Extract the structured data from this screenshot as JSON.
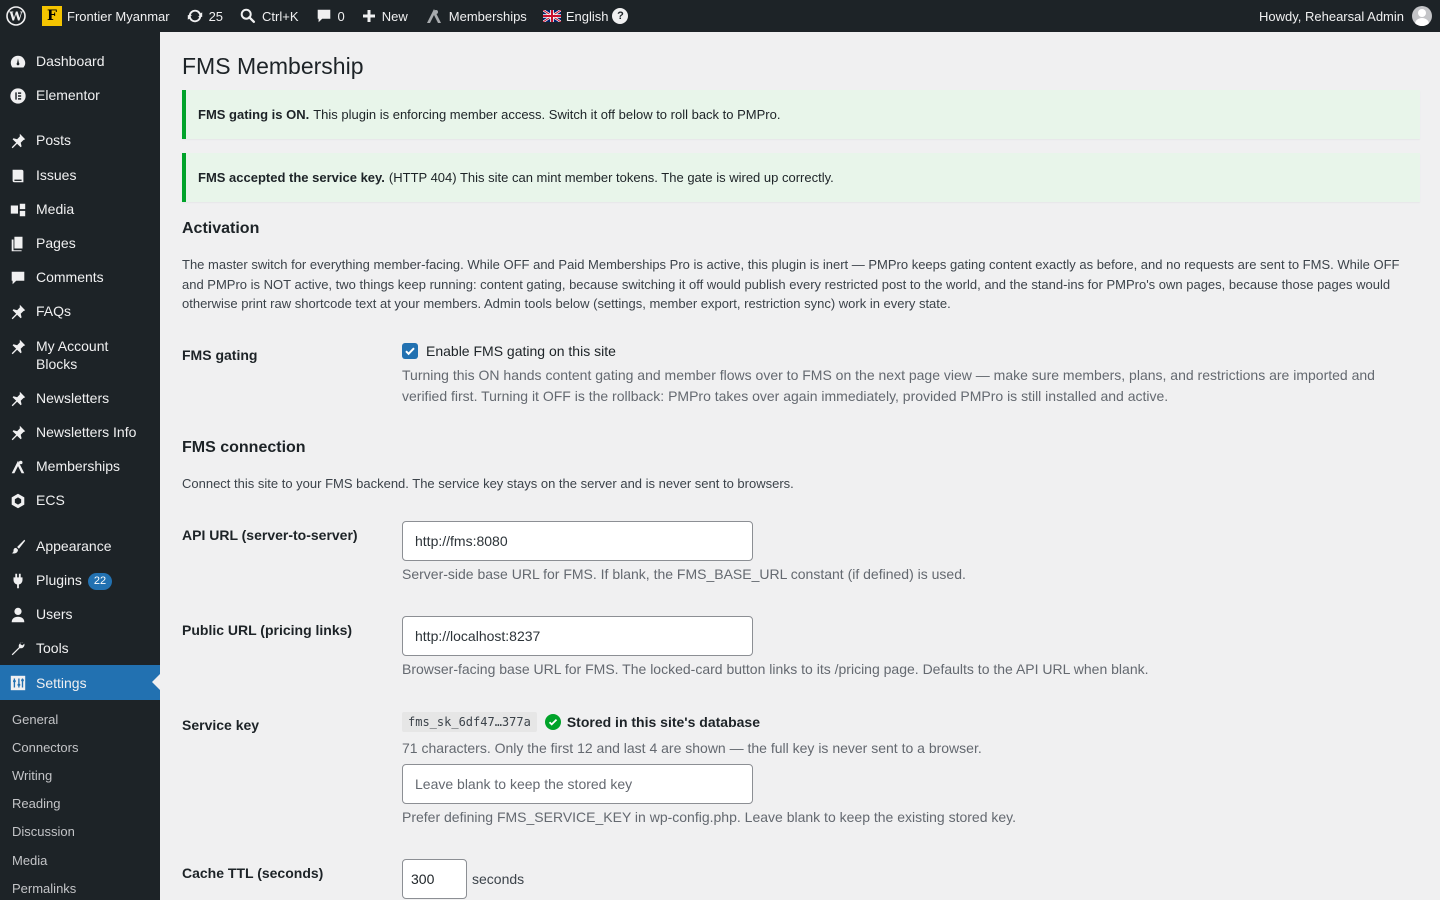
{
  "adminbar": {
    "site_name": "Frontier Myanmar",
    "site_logo_letter": "F",
    "updates_count": "25",
    "search_shortcut": "Ctrl+K",
    "comments_count": "0",
    "new_label": "New",
    "memberships_label": "Memberships",
    "language_label": "English",
    "help_glyph": "?",
    "greeting": "Howdy, Rehearsal Admin"
  },
  "sidebar": {
    "items": [
      {
        "label": "Dashboard",
        "icon": "dashboard-icon"
      },
      {
        "label": "Elementor",
        "icon": "elementor-icon"
      },
      {
        "label": "Posts",
        "icon": "pin-icon"
      },
      {
        "label": "Issues",
        "icon": "book-icon"
      },
      {
        "label": "Media",
        "icon": "media-icon"
      },
      {
        "label": "Pages",
        "icon": "pages-icon"
      },
      {
        "label": "Comments",
        "icon": "comment-icon"
      },
      {
        "label": "FAQs",
        "icon": "pin-icon"
      },
      {
        "label": "My Account Blocks",
        "icon": "pin-icon"
      },
      {
        "label": "Newsletters",
        "icon": "pin-icon"
      },
      {
        "label": "Newsletters Info",
        "icon": "pin-icon"
      },
      {
        "label": "Memberships",
        "icon": "memberships-icon"
      },
      {
        "label": "ECS",
        "icon": "ecs-icon"
      },
      {
        "label": "Appearance",
        "icon": "brush-icon"
      },
      {
        "label": "Plugins",
        "icon": "plug-icon",
        "badge": "22"
      },
      {
        "label": "Users",
        "icon": "user-icon"
      },
      {
        "label": "Tools",
        "icon": "wrench-icon"
      },
      {
        "label": "Settings",
        "icon": "settings-icon"
      }
    ],
    "submenu": [
      "General",
      "Connectors",
      "Writing",
      "Reading",
      "Discussion",
      "Media",
      "Permalinks"
    ]
  },
  "page": {
    "title": "FMS Membership",
    "notice1": {
      "bold": "FMS gating is ON.",
      "text": "This plugin is enforcing member access. Switch it off below to roll back to PMPro."
    },
    "notice2": {
      "bold": "FMS accepted the service key.",
      "text": "(HTTP 404) This site can mint member tokens. The gate is wired up correctly."
    },
    "activation": {
      "heading": "Activation",
      "description": "The master switch for everything member-facing. While OFF and Paid Memberships Pro is active, this plugin is inert — PMPro keeps gating content exactly as before, and no requests are sent to FMS. While OFF and PMPro is NOT active, two things keep running: content gating, because switching it off would publish every restricted post to the world, and the stand-ins for PMPro's own pages, because those pages would otherwise print raw shortcode text at your members. Admin tools below (settings, member export, restriction sync) work in every state.",
      "gating_label": "FMS gating",
      "gating_checkbox_label": "Enable FMS gating on this site",
      "gating_checked": true,
      "gating_help": "Turning this ON hands content gating and member flows over to FMS on the next page view — make sure members, plans, and restrictions are imported and verified first. Turning it OFF is the rollback: PMPro takes over again immediately, provided PMPro is still installed and active."
    },
    "connection": {
      "heading": "FMS connection",
      "description": "Connect this site to your FMS backend. The service key stays on the server and is never sent to browsers.",
      "api_url_label": "API URL (server-to-server)",
      "api_url_value": "http://fms:8080",
      "api_url_help": "Server-side base URL for FMS. If blank, the FMS_BASE_URL constant (if defined) is used.",
      "public_url_label": "Public URL (pricing links)",
      "public_url_value": "http://localhost:8237",
      "public_url_help": "Browser-facing base URL for FMS. The locked-card button links to its /pricing page. Defaults to the API URL when blank.",
      "service_key_label": "Service key",
      "service_key_masked": "fms_sk_6df47…377a",
      "service_key_status": "Stored in this site's database",
      "service_key_info": "71 characters. Only the first 12 and last 4 are shown — the full key is never sent to a browser.",
      "service_key_placeholder": "Leave blank to keep the stored key",
      "service_key_help": "Prefer defining FMS_SERVICE_KEY in wp-config.php. Leave blank to keep the existing stored key.",
      "cache_ttl_label": "Cache TTL (seconds)",
      "cache_ttl_value": "300",
      "cache_ttl_unit": "seconds"
    }
  }
}
